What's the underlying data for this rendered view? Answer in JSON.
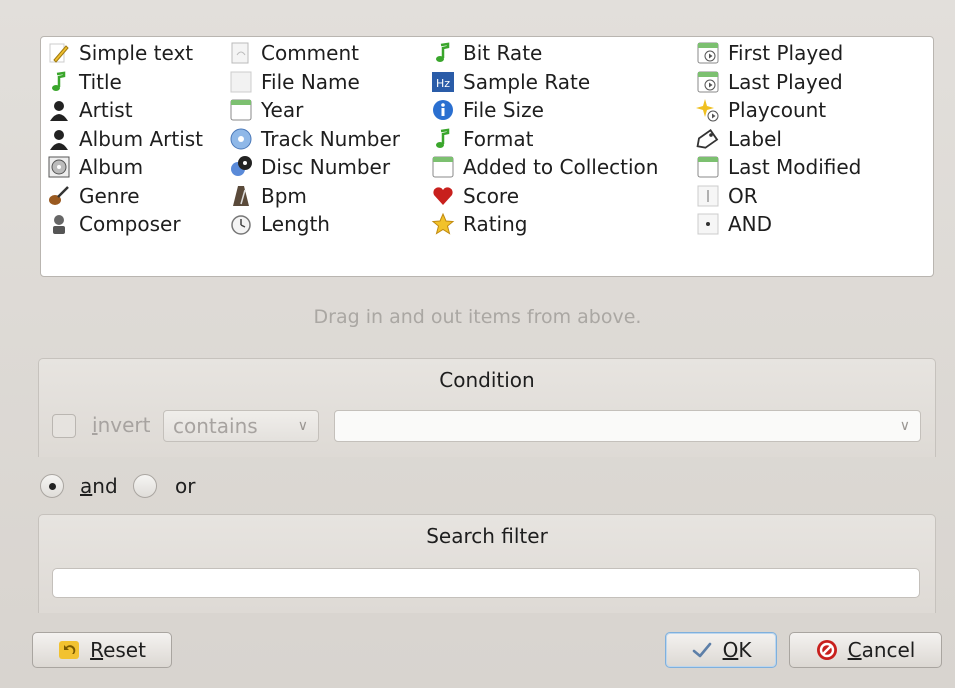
{
  "fields": {
    "col1": [
      {
        "label": "Simple text",
        "icon": "pencil-icon"
      },
      {
        "label": "Title",
        "icon": "music-note-icon"
      },
      {
        "label": "Artist",
        "icon": "person-icon"
      },
      {
        "label": "Album Artist",
        "icon": "person-icon"
      },
      {
        "label": "Album",
        "icon": "cd-icon"
      },
      {
        "label": "Genre",
        "icon": "guitar-icon"
      },
      {
        "label": "Composer",
        "icon": "bust-icon"
      }
    ],
    "col2": [
      {
        "label": "Comment",
        "icon": "comment-icon"
      },
      {
        "label": "File Name",
        "icon": "file-icon"
      },
      {
        "label": "Year",
        "icon": "calendar-icon"
      },
      {
        "label": "Track Number",
        "icon": "cd-track-icon"
      },
      {
        "label": "Disc Number",
        "icon": "disc-icon"
      },
      {
        "label": "Bpm",
        "icon": "metronome-icon"
      },
      {
        "label": "Length",
        "icon": "clock-icon"
      }
    ],
    "col3": [
      {
        "label": "Bit Rate",
        "icon": "music-note-icon"
      },
      {
        "label": "Sample Rate",
        "icon": "hz-icon"
      },
      {
        "label": "File Size",
        "icon": "info-icon"
      },
      {
        "label": "Format",
        "icon": "music-note-icon"
      },
      {
        "label": "Added to Collection",
        "icon": "calendar-icon"
      },
      {
        "label": "Score",
        "icon": "heart-icon"
      },
      {
        "label": "Rating",
        "icon": "star-icon"
      }
    ],
    "col4": [
      {
        "label": "First Played",
        "icon": "calendar-play-icon"
      },
      {
        "label": "Last Played",
        "icon": "calendar-play-icon"
      },
      {
        "label": "Playcount",
        "icon": "sparkle-icon"
      },
      {
        "label": "Label",
        "icon": "tag-icon"
      },
      {
        "label": "Last Modified",
        "icon": "calendar-icon"
      },
      {
        "label": "OR",
        "icon": "or-icon"
      },
      {
        "label": "AND",
        "icon": "and-icon"
      }
    ]
  },
  "hint": "Drag in and out items from above.",
  "condition": {
    "title": "Condition",
    "invert_label_u": "i",
    "invert_label_rest": "nvert",
    "operator": "contains",
    "value": ""
  },
  "logic": {
    "and_u": "a",
    "and_rest": "nd",
    "or": "or",
    "selected": "and"
  },
  "search": {
    "title": "Search filter",
    "value": ""
  },
  "buttons": {
    "reset_u": "R",
    "reset_rest": "eset",
    "ok_u": "O",
    "ok_rest": "K",
    "cancel_u": "C",
    "cancel_rest": "ancel"
  }
}
